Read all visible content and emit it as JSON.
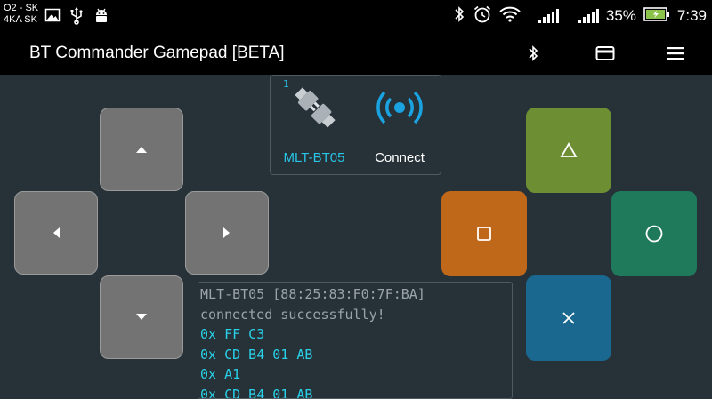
{
  "status_bar": {
    "carrier_line1": "O2 - SK",
    "carrier_line2": "4KA SK",
    "icons_left": [
      "image-icon",
      "usb-icon",
      "android-debug-icon"
    ],
    "icons_right": [
      "bluetooth-icon",
      "alarm-icon",
      "wifi-icon",
      "signal-icon",
      "signal-icon"
    ],
    "battery": "35%",
    "time": "7:39",
    "battery_color": "#8bc34a"
  },
  "app_bar": {
    "title": "BT Commander Gamepad [BETA]",
    "actions": [
      "bluetooth-icon",
      "card-icon",
      "menu-icon"
    ]
  },
  "connection_panel": {
    "badge": "1",
    "device_name": "MLT-BT05",
    "action_label": "Connect",
    "device_icon": "plug-connector-icon",
    "action_icon": "wireless-broadcast-icon"
  },
  "dpad": {
    "buttons": [
      "up",
      "left",
      "right",
      "down"
    ],
    "color": "#737373"
  },
  "action_buttons": {
    "triangle": {
      "color": "#6e8e34"
    },
    "square": {
      "color": "#c0681a"
    },
    "circle": {
      "color": "#1f7a5c"
    },
    "cross": {
      "color": "#1a6890"
    }
  },
  "log": {
    "lines": [
      "MLT-BT05 [88:25:83:F0:7F:BA]",
      "connected successfully!",
      "0x FF C3",
      "0x CD B4 01 AB",
      "0x A1",
      "0x CD B4 01 AB"
    ]
  }
}
